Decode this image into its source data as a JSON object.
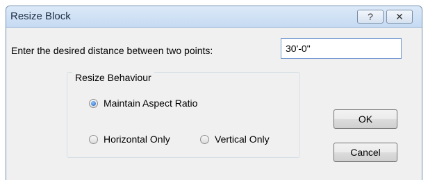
{
  "window": {
    "title": "Resize Block",
    "help_symbol": "?",
    "close_symbol": "✕"
  },
  "form": {
    "prompt": "Enter the desired distance between two points:",
    "distance_value": "30'-0\""
  },
  "resize_behaviour": {
    "legend": "Resize Behaviour",
    "options": [
      {
        "label": "Maintain Aspect Ratio",
        "checked": true
      },
      {
        "label": "Horizontal Only",
        "checked": false
      },
      {
        "label": "Vertical Only",
        "checked": false
      }
    ]
  },
  "buttons": {
    "ok": "OK",
    "cancel": "Cancel"
  }
}
